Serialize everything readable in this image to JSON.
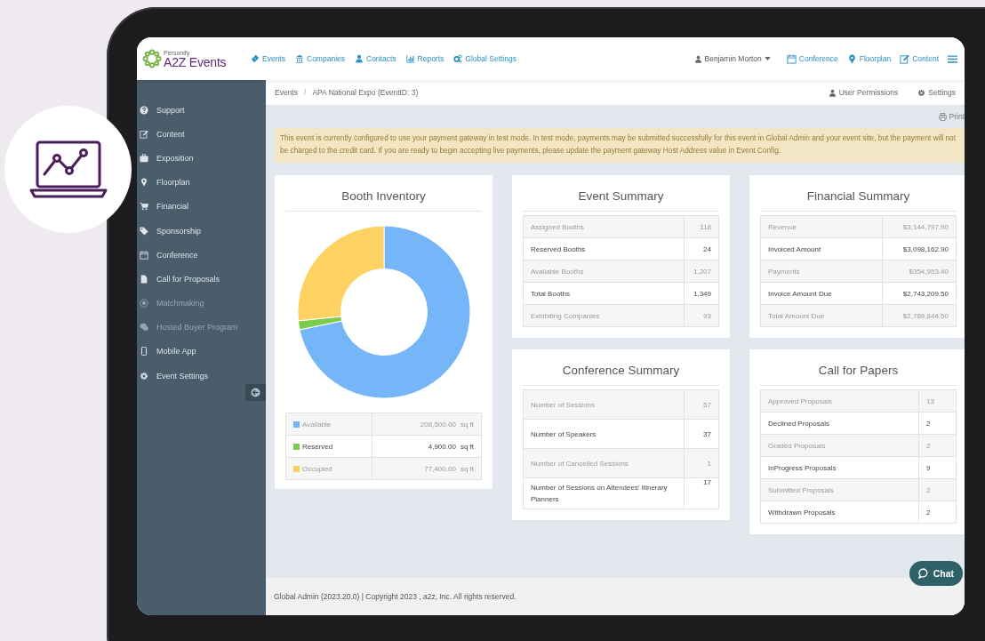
{
  "header": {
    "logo": {
      "brand": "Personify",
      "name": "A2Z Events"
    },
    "nav": [
      {
        "label": "Events"
      },
      {
        "label": "Companies"
      },
      {
        "label": "Contacts"
      },
      {
        "label": "Reports"
      },
      {
        "label": "Global Settings"
      }
    ],
    "user": "Benjamin Morton",
    "quick_links": [
      {
        "label": "Conference"
      },
      {
        "label": "Floorplan"
      },
      {
        "label": "Content"
      }
    ]
  },
  "sidebar": {
    "items": [
      {
        "label": "Support",
        "disabled": false
      },
      {
        "label": "Content",
        "disabled": false
      },
      {
        "label": "Exposition",
        "disabled": false
      },
      {
        "label": "Floorplan",
        "disabled": false
      },
      {
        "label": "Financial",
        "disabled": false
      },
      {
        "label": "Sponsorship",
        "disabled": false
      },
      {
        "label": "Conference",
        "disabled": false
      },
      {
        "label": "Call for Proposals",
        "disabled": false
      },
      {
        "label": "Matchmaking",
        "disabled": true
      },
      {
        "label": "Hosted Buyer Program",
        "disabled": true
      },
      {
        "label": "Mobile App",
        "disabled": false
      },
      {
        "label": "Event Settings",
        "disabled": false
      }
    ]
  },
  "breadcrumb": [
    "Events",
    "APA National Expo (EventID: 3)"
  ],
  "breadcrumb_separator": "/",
  "page_actions": [
    "User Permissions",
    "Settings"
  ],
  "print": "Print",
  "alert": "This event is currently configured to use your payment gateway in test mode. In test mode, payments may be submitted successfully for this event in Global Admin and your event site, but the payment will not be charged to the credit card. If you are ready to begin accepting live payments, please update the payment gateway Host Address value in Event Config.",
  "booth_inventory": {
    "title": "Booth Inventory",
    "chart_data": {
      "type": "donut",
      "categories": [
        "Available",
        "Reserved",
        "Occupied"
      ],
      "values": [
        71.7,
        1.68,
        26.62
      ]
    },
    "legend": [
      {
        "value": "208,500.00",
        "unit": "sq ft",
        "color": "#74b6f8"
      },
      {
        "value": "4,900.00",
        "unit": "sq ft",
        "color": "#7ccb4e"
      },
      {
        "value": "77,400.00",
        "unit": "sq ft",
        "color": "#fdd263"
      }
    ]
  },
  "event_summary": {
    "title": "Event Summary",
    "rows": [
      {
        "label": "Assigned Booths",
        "value": "118"
      },
      {
        "label": "Reserved Booths",
        "value": "24"
      },
      {
        "label": "Available Booths",
        "value": "1,207"
      },
      {
        "label": "Total Booths",
        "value": "1,349"
      },
      {
        "label": "Exhibiting Companies",
        "value": "93"
      }
    ]
  },
  "financial_summary": {
    "title": "Financial Summary",
    "rows": [
      {
        "label": "Revenue",
        "value": "$3,144,797.90"
      },
      {
        "label": "Invoiced Amount",
        "value": "$3,098,162.90"
      },
      {
        "label": "Payments",
        "value": "$354,953.40"
      },
      {
        "label": "Invoice Amount Due",
        "value": "$2,743,209.50"
      },
      {
        "label": "Total Amount Due",
        "value": "$2,789,844.50"
      }
    ]
  },
  "conference_summary": {
    "title": "Conference Summary",
    "rows": [
      {
        "label": "Number of Sessions",
        "value": "57"
      },
      {
        "label": "Number of Speakers",
        "value": "37"
      },
      {
        "label": "Number of Cancelled Sessions",
        "value": "1"
      },
      {
        "label": "Number of Sessions on Attendees' Itinerary Planners",
        "value": "17"
      }
    ]
  },
  "call_for_papers": {
    "title": "Call for Papers",
    "rows": [
      {
        "label": "Approved Proposals",
        "value": "13"
      },
      {
        "label": "Declined Proposals",
        "value": "2"
      },
      {
        "label": "Graded Proposals",
        "value": "2"
      },
      {
        "label": "InProgress Proposals",
        "value": "9"
      },
      {
        "label": "Submitted Proposals",
        "value": "2"
      },
      {
        "label": "Withdrawn Proposals",
        "value": "2"
      }
    ]
  },
  "footer": "Global Admin (2023.20.0) | Copyright 2023 , a2z, Inc. All rights reserved.",
  "chat": "Chat"
}
